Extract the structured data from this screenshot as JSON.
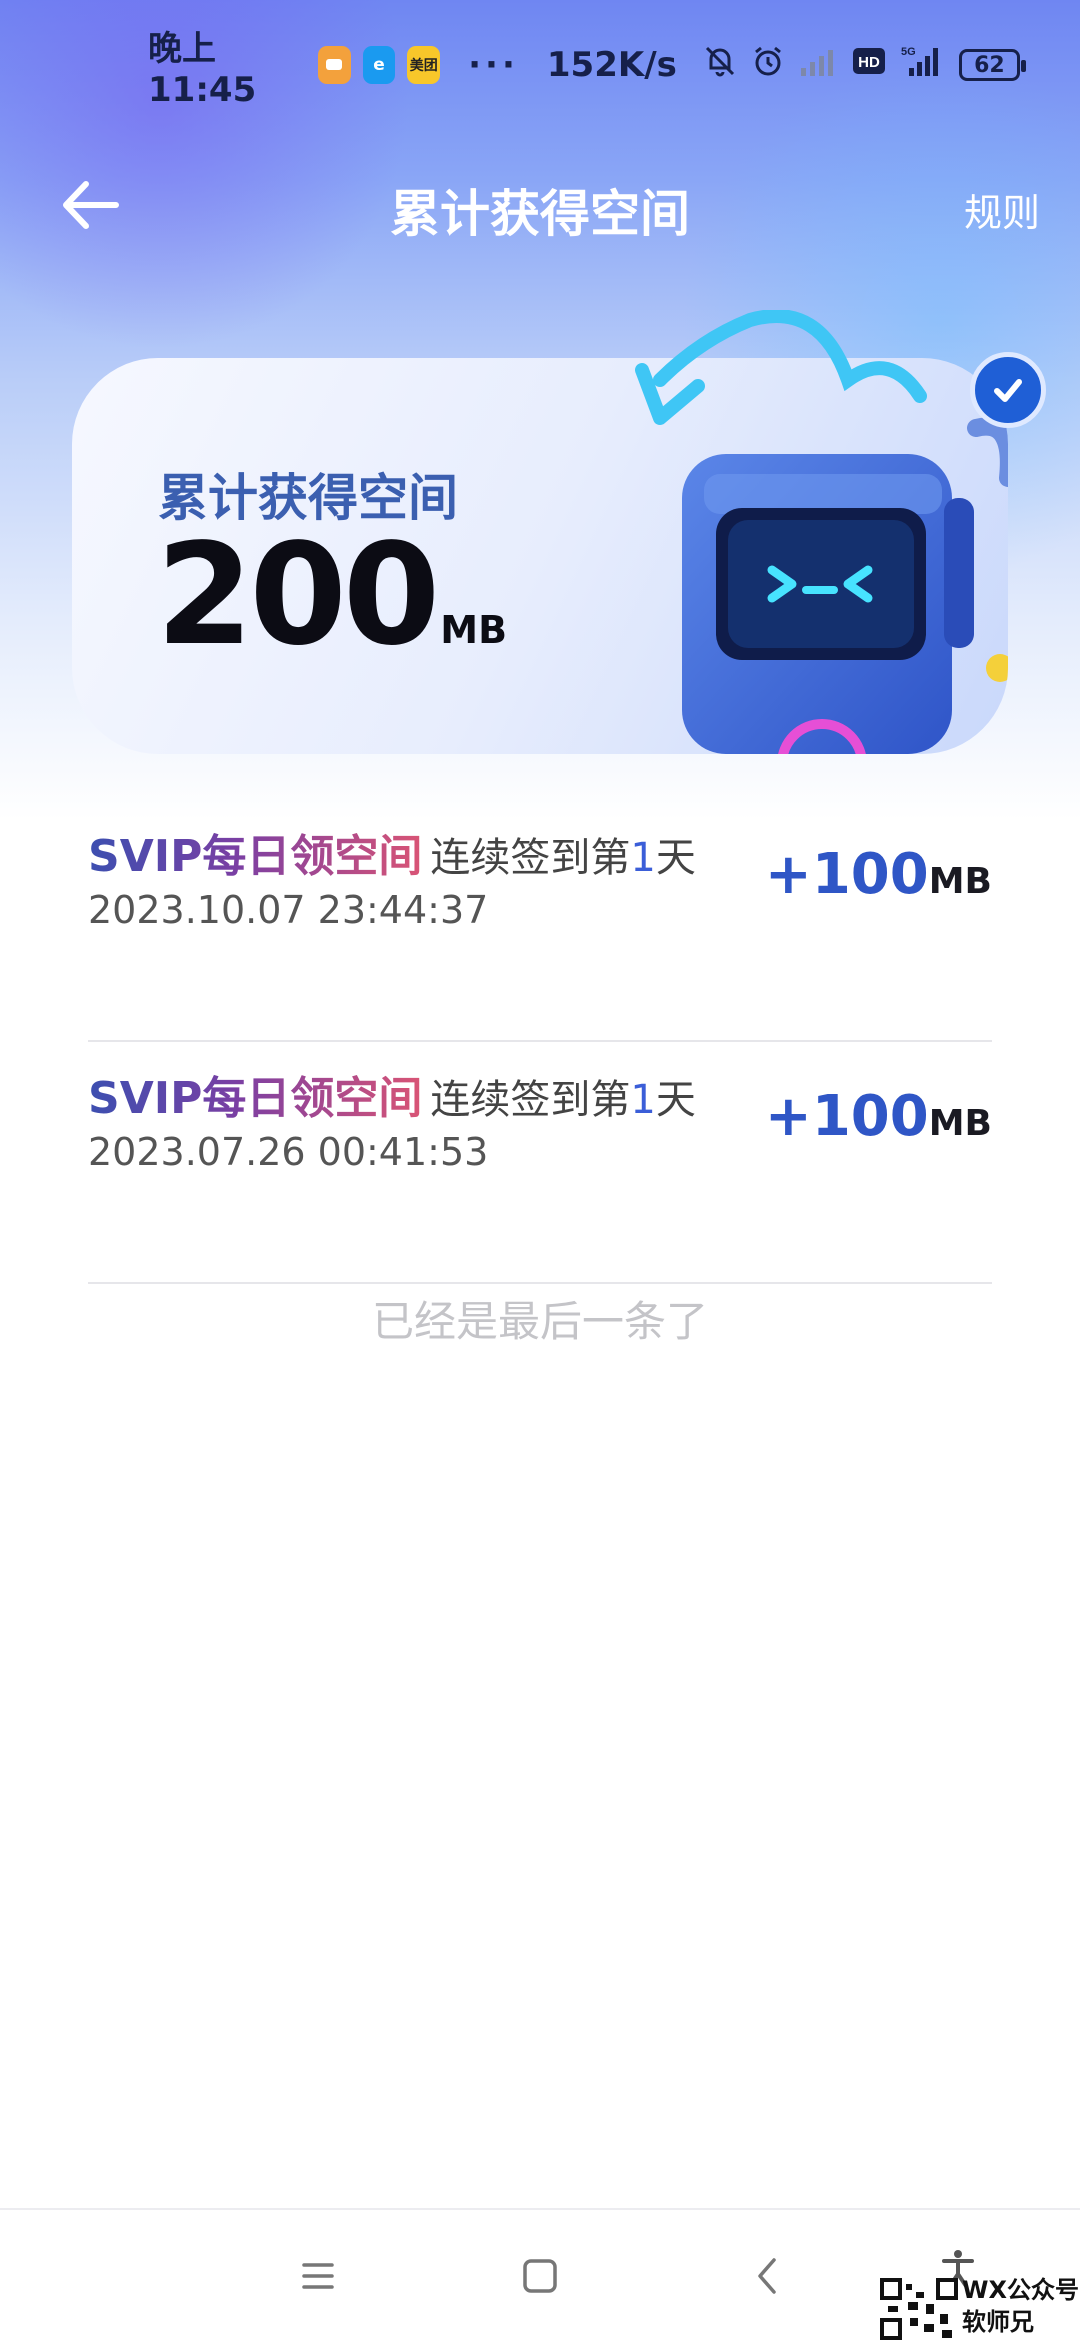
{
  "status_bar": {
    "time": "晚上11:45",
    "apps": [
      {
        "icon": "chat-app-icon",
        "label": "",
        "color": "#f3a13c"
      },
      {
        "icon": "eleme-app-icon",
        "label": "e",
        "color": "#1a9af0"
      },
      {
        "icon": "meituan-app-icon",
        "label": "美团",
        "color": "#f8c72a"
      }
    ],
    "more": "···",
    "net_speed": "152K/s",
    "battery": "62"
  },
  "header": {
    "title": "累计获得空间",
    "rules_label": "规则"
  },
  "summary": {
    "label": "累计获得空间",
    "value": "200",
    "unit": "MB"
  },
  "records": [
    {
      "tag": "SVIP每日领空间",
      "desc_prefix": "连续签到第",
      "day": "1",
      "desc_suffix": "天",
      "date": "2023.10.07 23:44:37",
      "amount": "+100",
      "unit": "MB"
    },
    {
      "tag": "SVIP每日领空间",
      "desc_prefix": "连续签到第",
      "day": "1",
      "desc_suffix": "天",
      "date": "2023.07.26 00:41:53",
      "amount": "+100",
      "unit": "MB"
    }
  ],
  "end_note": "已经是最后一条了",
  "watermark": {
    "line1": "WX公众号",
    "line2": "软师兄"
  },
  "colors": {
    "accent": "#2f56c6",
    "card_label": "#3b5fb0",
    "end_note": "#c4c4c8"
  }
}
